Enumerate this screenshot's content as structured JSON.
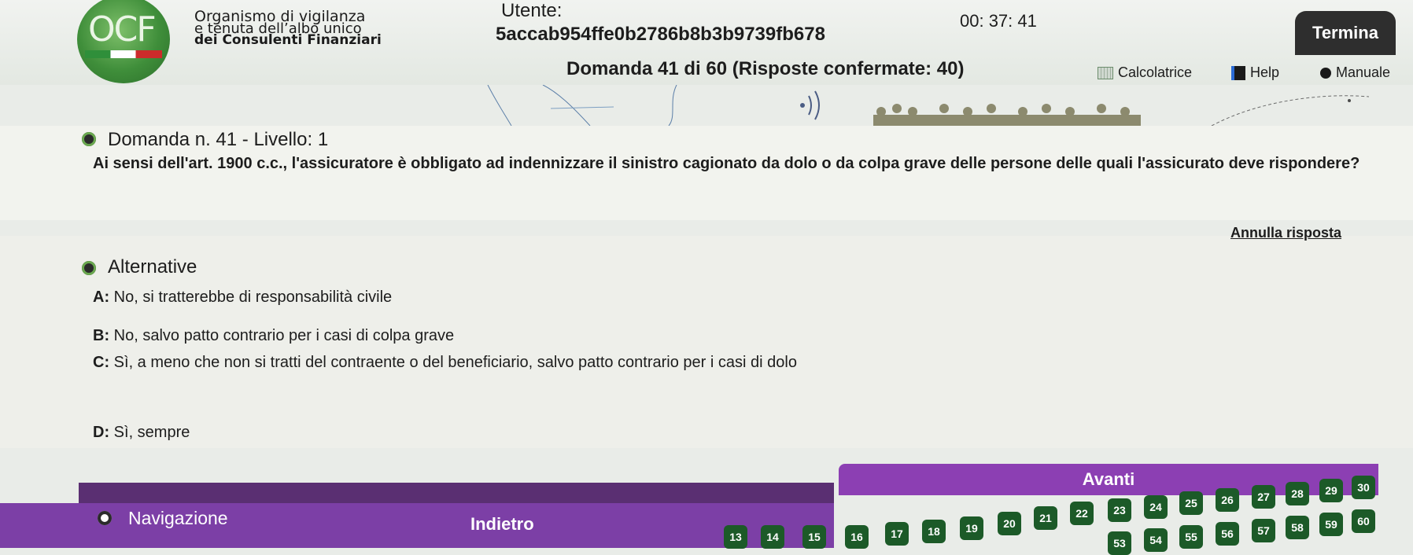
{
  "header": {
    "logo_text": "OCF",
    "org_line1": "Organismo di vigilanza",
    "org_line2": "e tenuta dell’albo unico",
    "org_line3": "dei Consulenti Finanziari",
    "user_label": "Utente:",
    "user_id": "5accab954ffe0b2786b8b3b9739fb678",
    "timer": "00: 37: 41",
    "termina_label": "Termina",
    "domanda_title": "Domanda 41 di 60 (Risposte confermate: 40)",
    "tools": {
      "calc": "Calcolatrice",
      "help": "Help",
      "manuale": "Manuale"
    }
  },
  "question": {
    "section_title": "Domanda n. 41 - Livello: 1",
    "text": "Ai sensi dell'art. 1900 c.c., l'assicuratore è obbligato ad indennizzare il sinistro cagionato da dolo o da colpa grave delle persone delle quali l'assicurato deve rispondere?"
  },
  "alternatives": {
    "annulla": "Annulla risposta",
    "section_title": "Alternative",
    "options": [
      {
        "letter": "A:",
        "text": "No, si tratterebbe di responsabilità civile"
      },
      {
        "letter": "B:",
        "text": "No, salvo patto contrario per i casi di colpa grave"
      },
      {
        "letter": "C:",
        "text": "Sì, a meno che non si tratti del contraente o del beneficiario, salvo patto contrario per i casi di dolo"
      },
      {
        "letter": "D:",
        "text": "Sì, sempre"
      }
    ]
  },
  "navigation": {
    "avanti": "Avanti",
    "indietro": "Indietro",
    "title": "Navigazione",
    "row1": [
      "21",
      "22",
      "23",
      "24",
      "25",
      "26",
      "27",
      "28",
      "29",
      "30"
    ],
    "row2": [
      "13",
      "14",
      "15",
      "16",
      "17",
      "18",
      "19",
      "20"
    ],
    "row3": [
      "53",
      "54",
      "55",
      "56",
      "57",
      "58",
      "59",
      "60"
    ]
  },
  "colors": {
    "accent_purple": "#8c3fb3",
    "box_green": "#1c5a28",
    "logo_green": "#3f8e3a"
  }
}
